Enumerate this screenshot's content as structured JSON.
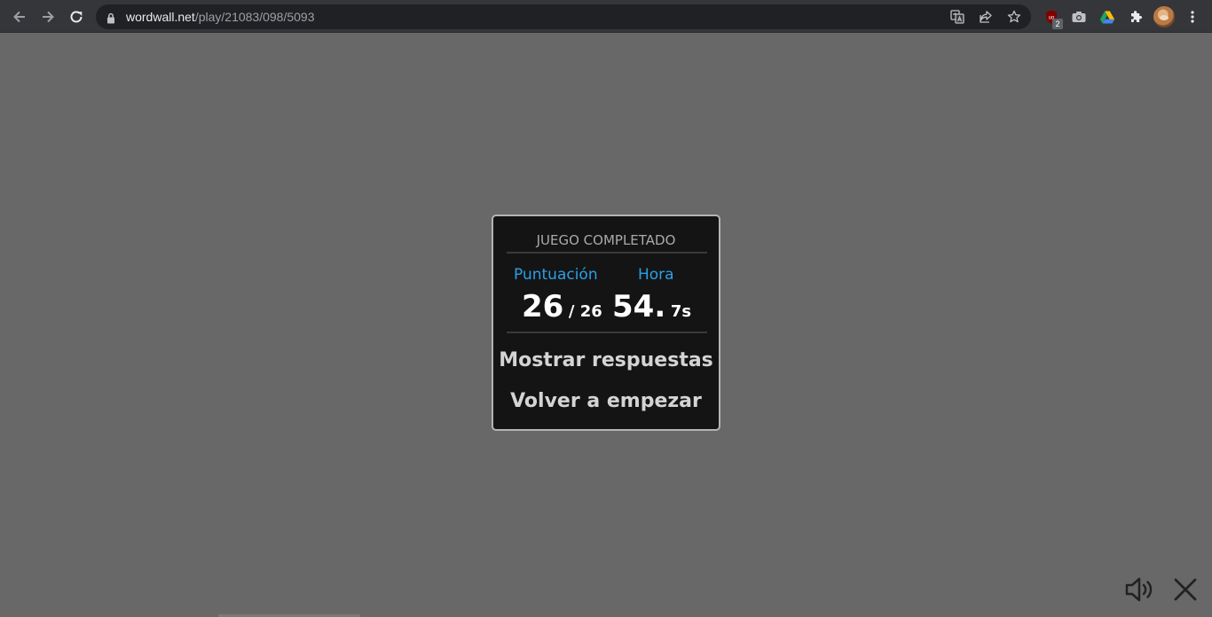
{
  "browser": {
    "url_host": "wordwall.net",
    "url_path": "/play/21083/098/5093",
    "icons": {
      "back": "back-arrow-icon",
      "forward": "forward-arrow-icon",
      "reload": "reload-icon",
      "lock": "lock-icon",
      "translate": "translate-icon",
      "share": "share-icon",
      "bookmark": "star-icon",
      "ublock": "ublock-icon",
      "camera": "camera-icon",
      "drive": "drive-icon",
      "extensions": "puzzle-icon",
      "menu": "kebab-menu-icon"
    },
    "ublock_badge": "2"
  },
  "modal": {
    "title": "JUEGO COMPLETADO",
    "score_label": "Puntuación",
    "time_label": "Hora",
    "score_value": "26",
    "score_total": "/ 26",
    "time_int": "54.",
    "time_frac": "7s",
    "show_answers": "Mostrar respuestas",
    "restart": "Volver a empezar"
  },
  "controls": {
    "sound_icon": "speaker-icon",
    "close_icon": "close-icon"
  },
  "colors": {
    "background": "#686868",
    "modal_bg": "#141414",
    "label_blue": "#2aa0e8",
    "toolbar": "#35363a"
  }
}
